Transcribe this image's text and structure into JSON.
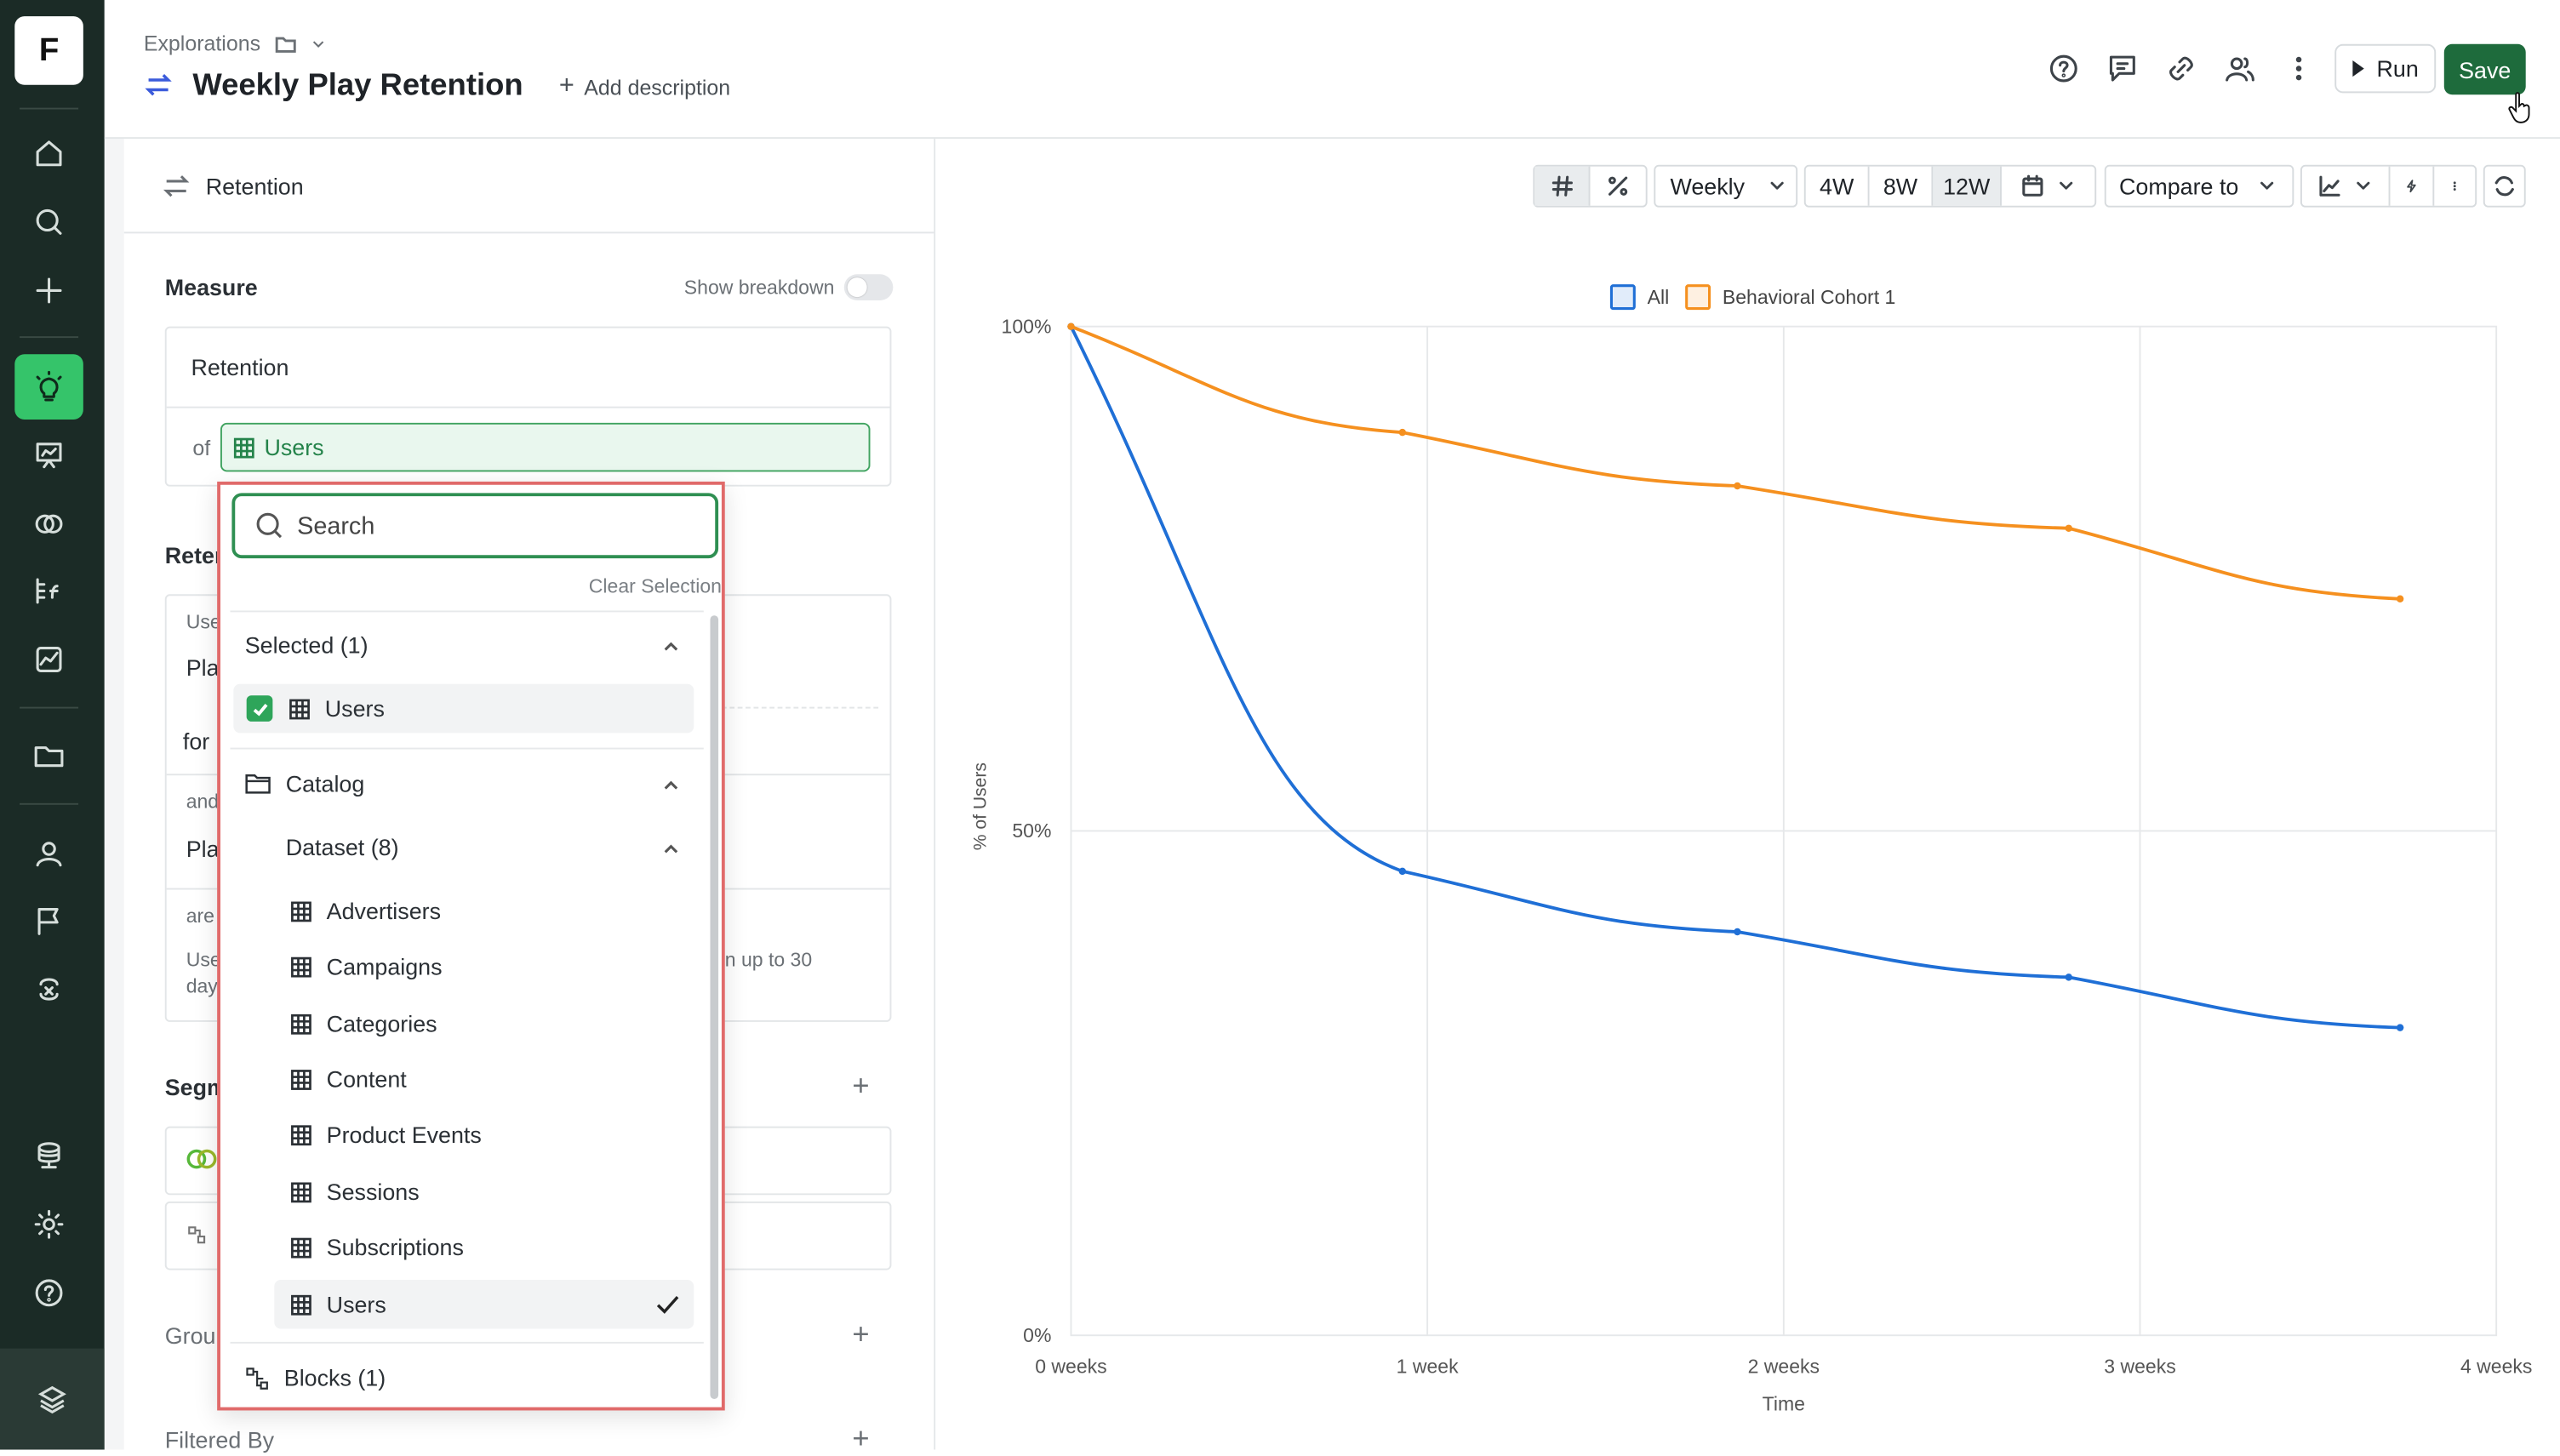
{
  "app": {
    "logo_letter": "F"
  },
  "header": {
    "breadcrumb": "Explorations",
    "title": "Weekly Play Retention",
    "add_description": "Add description",
    "run_label": "Run",
    "save_label": "Save"
  },
  "panel": {
    "header": "Retention",
    "measure_label": "Measure",
    "show_breakdown": "Show breakdown",
    "measure_name": "Retention",
    "of_label": "of",
    "of_value": "Users",
    "fragments": {
      "retention_cut": "Reter",
      "use_cut": "Use",
      "pla_cut_1": "Pla",
      "for_cut": "for",
      "and_cut": "and",
      "pla_cut_2": "Pla",
      "are_cut": "are",
      "use_cut_2": "Use",
      "day_cut": "day",
      "tail_text": "n up to 30",
      "segment_cut": "Segm",
      "group_cut": "Grou",
      "filtered_by": "Filtered By"
    }
  },
  "dropdown": {
    "search_placeholder": "Search",
    "clear_selection": "Clear Selection",
    "selected_header": "Selected (1)",
    "selected_items": [
      "Users"
    ],
    "catalog_header": "Catalog",
    "dataset_header": "Dataset (8)",
    "datasets": [
      "Advertisers",
      "Campaigns",
      "Categories",
      "Content",
      "Product Events",
      "Sessions",
      "Subscriptions",
      "Users"
    ],
    "checked_dataset": "Users",
    "blocks_header": "Blocks (1)"
  },
  "toolbar": {
    "granularity": "Weekly",
    "ranges": [
      "4W",
      "8W",
      "12W"
    ],
    "active_range": "12W",
    "compare_to": "Compare to"
  },
  "chart_data": {
    "type": "line",
    "x": [
      "0 weeks",
      "1 week",
      "2 weeks",
      "3 weeks",
      "4 weeks"
    ],
    "xlabel": "Time",
    "ylabel": "% of Users",
    "yticks": [
      "100%",
      "50%",
      "0%"
    ],
    "ylim": [
      0,
      100
    ],
    "legend_position": "top-center",
    "grid": true,
    "series": [
      {
        "name": "All",
        "color": "#1f6fd6",
        "x": [
          0,
          0.93,
          1.87,
          2.8,
          3.73
        ],
        "values": [
          100,
          46,
          40,
          35.5,
          30.5
        ]
      },
      {
        "name": "Behavioral Cohort 1",
        "color": "#f5901f",
        "x": [
          0,
          0.93,
          1.87,
          2.8,
          3.73
        ],
        "values": [
          100,
          89.5,
          84.2,
          80,
          73
        ]
      }
    ]
  },
  "colors": {
    "accent": "#35c46a",
    "save": "#1e6b3c",
    "rail": "#1b2b26",
    "highlight": "#e06a6a"
  }
}
